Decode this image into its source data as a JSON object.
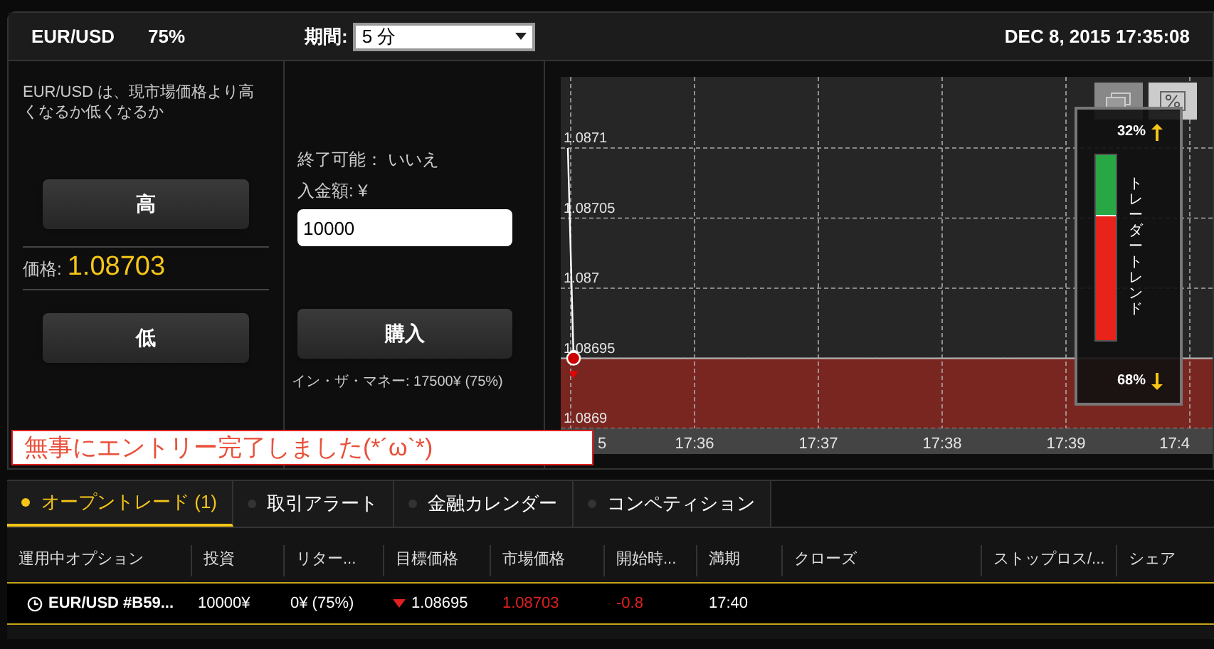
{
  "header": {
    "symbol": "EUR/USD",
    "payout": "75%",
    "period_label": "期間:",
    "period_value": "5 分",
    "datetime": "DEC 8, 2015 17:35:08"
  },
  "left": {
    "question": "EUR/USD は、現市場価格より高くなるか低くなるか",
    "high_button": "高",
    "price_label": "価格:",
    "price": "1.08703",
    "low_button": "低"
  },
  "middle": {
    "closable": "終了可能： いいえ",
    "amount_label": "入金額: ¥",
    "amount_value": "10000",
    "buy_button": "購入",
    "in_the_money": "イン・ザ・マネー: 17500¥ (75%)"
  },
  "chart": {
    "y_labels": [
      "1.0871",
      "1.08705",
      "1.087",
      "1.08695",
      "1.0869"
    ],
    "x_labels": [
      "5",
      "17:36",
      "17:37",
      "17:38",
      "17:39",
      "17:4"
    ],
    "trader_trend": {
      "title": "トレーダートレンド",
      "up": "32%",
      "down": "68%",
      "level": 0.32
    }
  },
  "toast": "無事にエントリー完了しました(*´ω`*)",
  "tabs": [
    {
      "label": "オープントレード (1)",
      "selected": true
    },
    {
      "label": "取引アラート",
      "selected": false
    },
    {
      "label": "金融カレンダー",
      "selected": false
    },
    {
      "label": "コンペティション",
      "selected": false
    }
  ],
  "table": {
    "columns": [
      "運用中オプション",
      "投資",
      "リター...",
      "目標価格",
      "市場価格",
      "開始時...",
      "満期",
      "クローズ",
      "ストップロス/...",
      "シェア"
    ],
    "rows": [
      {
        "option": "EUR/USD #B59...",
        "investment": "10000¥",
        "return": "0¥ (75%)",
        "falling": true,
        "target": "1.08695",
        "market": "1.08703",
        "change": "-0.8",
        "expiry": "17:40"
      }
    ]
  }
}
